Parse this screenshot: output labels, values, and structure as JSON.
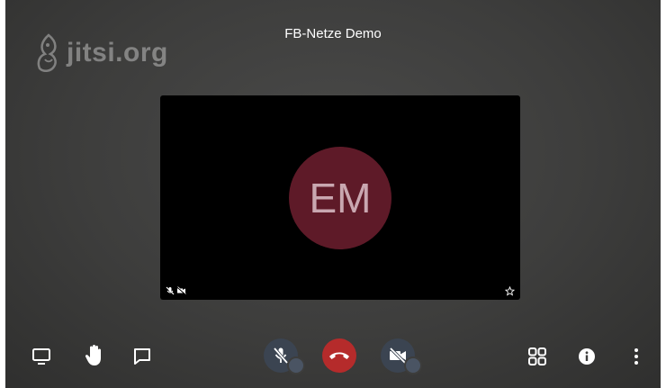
{
  "meeting": {
    "title": "FB-Netze Demo"
  },
  "logo": {
    "text": "jitsi.org"
  },
  "participant": {
    "initials": "EM",
    "avatar_color": "#5e1a28"
  },
  "toolbar": {
    "left": [
      {
        "icon": "share-screen-icon"
      },
      {
        "icon": "raise-hand-icon"
      },
      {
        "icon": "chat-icon"
      }
    ],
    "center": [
      {
        "icon": "microphone-muted-icon"
      },
      {
        "icon": "hangup-icon",
        "color": "#b52b2b"
      },
      {
        "icon": "camera-off-icon"
      }
    ],
    "right": [
      {
        "icon": "tile-view-icon"
      },
      {
        "icon": "info-icon"
      },
      {
        "icon": "more-options-icon"
      }
    ]
  }
}
